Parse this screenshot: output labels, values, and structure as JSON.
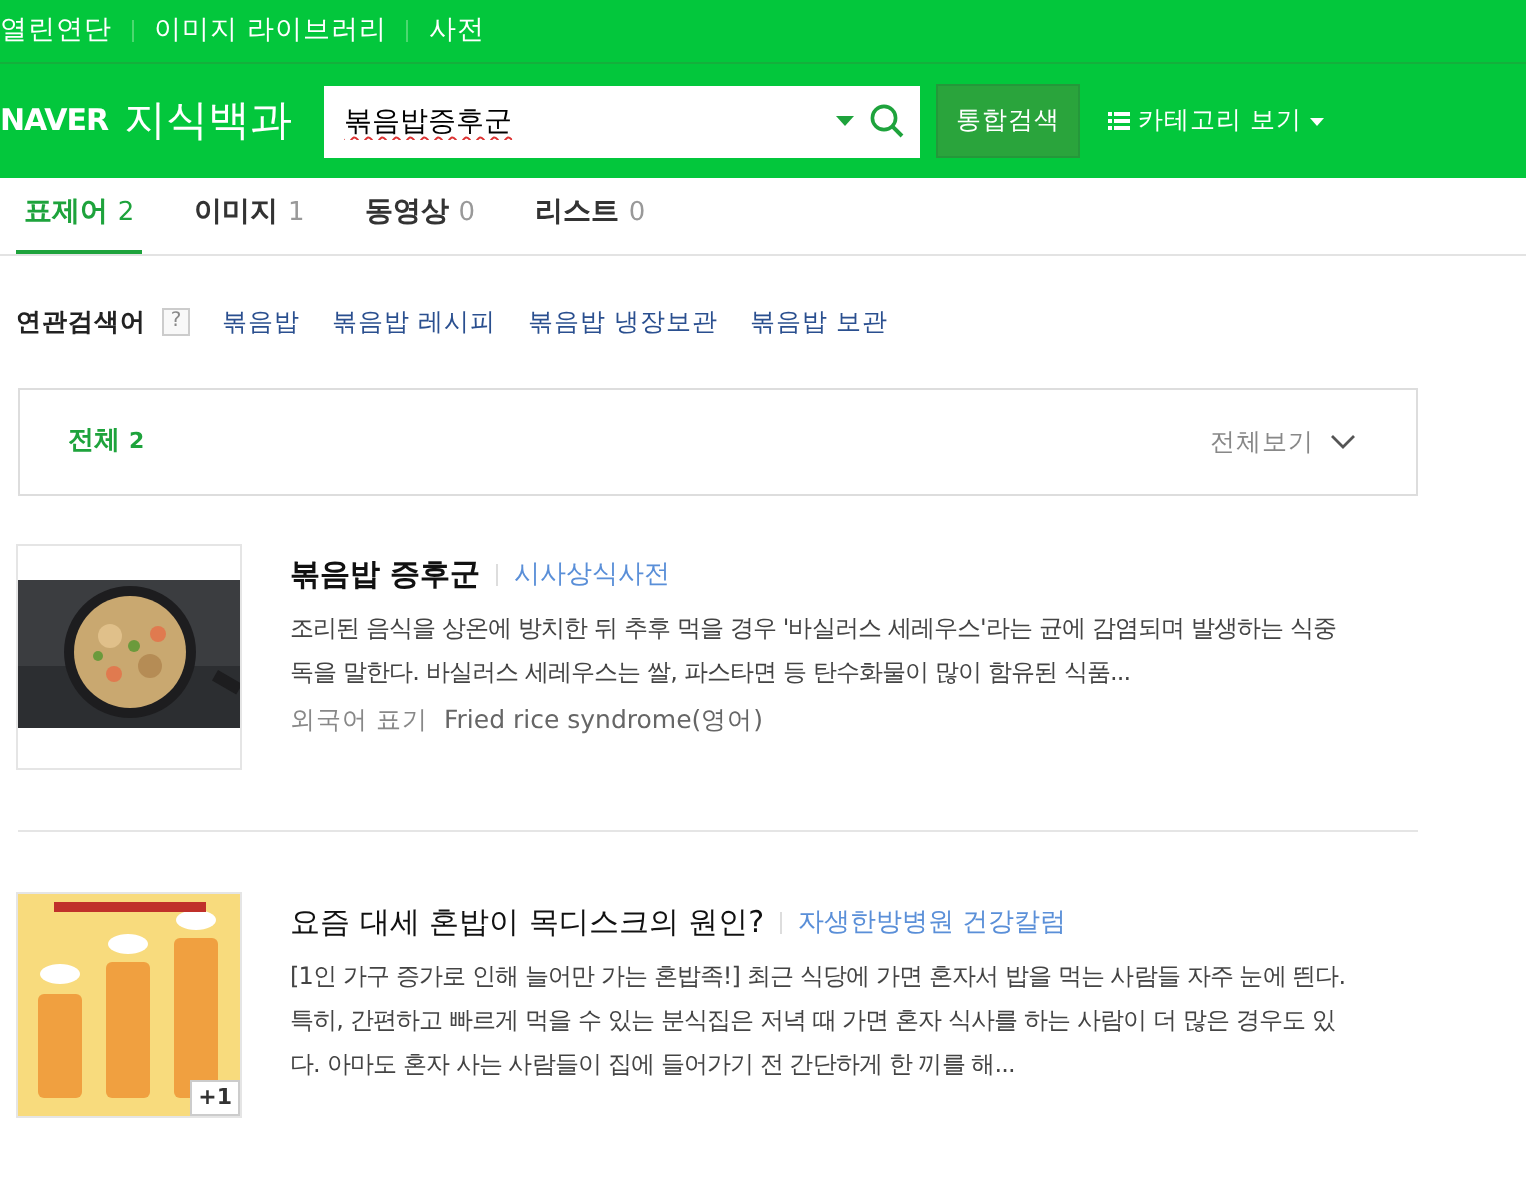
{
  "top_links": [
    "열린연단",
    "이미지 라이브러리",
    "사전"
  ],
  "logo": {
    "brand": "NAVER",
    "service": "지식백과"
  },
  "search": {
    "value": "볶음밥증후군"
  },
  "search_button": "통합검색",
  "category_button": "카테고리 보기",
  "tabs": [
    {
      "label": "표제어",
      "count": "2",
      "selected": true
    },
    {
      "label": "이미지",
      "count": "1",
      "selected": false
    },
    {
      "label": "동영상",
      "count": "0",
      "selected": false
    },
    {
      "label": "리스트",
      "count": "0",
      "selected": false
    }
  ],
  "related": {
    "label": "연관검색어",
    "help": "?",
    "terms": [
      "볶음밥",
      "볶음밥 레시피",
      "볶음밥 냉장보관",
      "볶음밥 보관"
    ]
  },
  "filter": {
    "label": "전체",
    "count": "2",
    "view_all": "전체보기"
  },
  "results": [
    {
      "title": "볶음밥 증후군",
      "bold": true,
      "source": "시사상식사전",
      "snippet": "조리된 음식을 상온에 방치한 뒤 추후 먹을 경우 '바실러스 세레우스'라는 균에 감염되며 발생하는 식중독을 말한다. 바실러스 세레우스는 쌀, 파스타면 등 탄수화물이 많이 함유된 식품...",
      "meta_label": "외국어 표기",
      "meta_value": "Fried rice syndrome(영어)"
    },
    {
      "title": "요즘 대세 혼밥이 목디스크의 원인?",
      "bold": false,
      "source": "자생한방병원 건강칼럼",
      "snippet": "[1인 가구 증가로 인해 늘어만 가는 혼밥족!] 최근 식당에 가면 혼자서 밥을 먹는 사람들 자주 눈에 띈다. 특히, 간편하고 빠르게 먹을 수 있는 분식집은 저녁 때 가면 혼자 식사를 하는 사람이 더 많은 경우도 있다. 아마도 혼자 사는 사람들이 집에 들어가기 전 간단하게 한 끼를 해...",
      "badge": "+1"
    }
  ]
}
